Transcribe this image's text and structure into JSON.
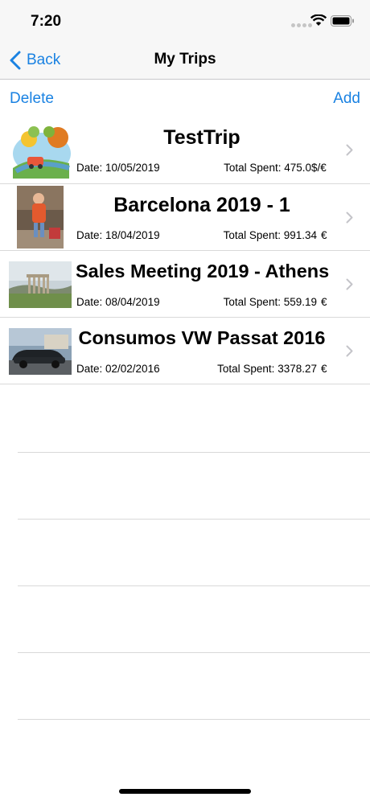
{
  "status": {
    "time": "7:20"
  },
  "nav": {
    "back_label": "Back",
    "title": "My Trips"
  },
  "toolbar": {
    "delete_label": "Delete",
    "add_label": "Add"
  },
  "trips": [
    {
      "title": "TestTrip",
      "date": "Date: 10/05/2019",
      "spent": "Total Spent: 475.0",
      "currency": "$/€",
      "image": "cartoon-landscape"
    },
    {
      "title": "Barcelona 2019 - 1",
      "date": "Date: 18/04/2019",
      "spent": "Total Spent: 991.34",
      "currency": "€",
      "image": "child-photo"
    },
    {
      "title": "Sales Meeting 2019 - Athens",
      "date": "Date: 08/04/2019",
      "spent": "Total Spent: 559.19",
      "currency": "€",
      "image": "ruins-photo"
    },
    {
      "title": "Consumos VW Passat 2016",
      "date": "Date: 02/02/2016",
      "spent": "Total Spent: 3378.27",
      "currency": "€",
      "image": "car-photo"
    }
  ],
  "colors": {
    "accent": "#1a82e2",
    "separator": "#d9d9d9"
  }
}
